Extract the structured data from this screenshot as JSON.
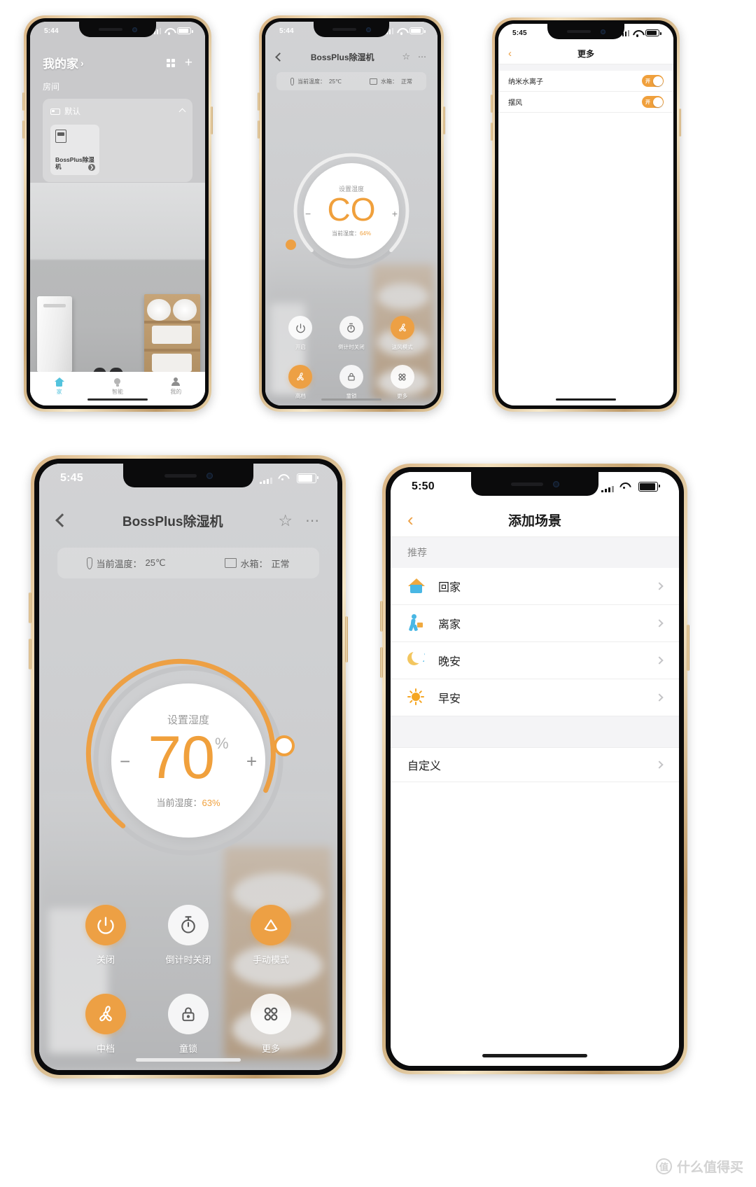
{
  "phones": {
    "home": {
      "status": {
        "time": "5:44"
      },
      "title": "我的家",
      "title_chevron": "›",
      "section_label": "房间",
      "room": {
        "name": "默认"
      },
      "device": {
        "name": "BossPlus除湿机",
        "arrow": "❯"
      },
      "tabs": [
        {
          "label": "家",
          "icon": "home-icon",
          "active": true
        },
        {
          "label": "智能",
          "icon": "bulb-icon",
          "active": false
        },
        {
          "label": "我的",
          "icon": "user-icon",
          "active": false
        }
      ]
    },
    "control_small": {
      "status": {
        "time": "5:44"
      },
      "title": "BossPlus除湿机",
      "info": {
        "temp_label": "当前温度：",
        "temp_value": "25℃",
        "tank_label": "水箱：",
        "tank_value": "正常"
      },
      "dial": {
        "label": "设置湿度",
        "value": "CO",
        "pct": "",
        "current_label": "当前湿度：",
        "current_value": "64%",
        "minus": "−",
        "plus": "+"
      },
      "buttons": [
        {
          "label": "开启",
          "icon": "power-icon",
          "state": "off"
        },
        {
          "label": "倒计时关闭",
          "icon": "timer-icon",
          "state": "off"
        },
        {
          "label": "送风模式",
          "icon": "fan-icon",
          "state": "on"
        },
        {
          "label": "高档",
          "icon": "fan-speed-icon",
          "state": "on"
        },
        {
          "label": "童锁",
          "icon": "lock-icon",
          "state": "off"
        },
        {
          "label": "更多",
          "icon": "more-grid-icon",
          "state": "off"
        }
      ]
    },
    "more": {
      "status": {
        "time": "5:45"
      },
      "title": "更多",
      "rows": [
        {
          "label": "纳米水离子",
          "toggle": "开",
          "on": true
        },
        {
          "label": "摆风",
          "toggle": "开",
          "on": true
        }
      ]
    },
    "control_large": {
      "status": {
        "time": "5:45"
      },
      "title": "BossPlus除湿机",
      "info": {
        "temp_label": "当前温度：",
        "temp_value": "25℃",
        "tank_label": "水箱：",
        "tank_value": "正常"
      },
      "dial": {
        "label": "设置湿度",
        "value": "70",
        "pct": "%",
        "current_label": "当前湿度：",
        "current_value": "63%",
        "minus": "−",
        "plus": "+"
      },
      "buttons": [
        {
          "label": "关闭",
          "icon": "power-icon",
          "state": "on"
        },
        {
          "label": "倒计时关闭",
          "icon": "timer-icon",
          "state": "off"
        },
        {
          "label": "手动模式",
          "icon": "manual-mode-icon",
          "state": "on"
        },
        {
          "label": "中档",
          "icon": "fan-speed-icon",
          "state": "on"
        },
        {
          "label": "童锁",
          "icon": "lock-icon",
          "state": "off"
        },
        {
          "label": "更多",
          "icon": "more-grid-icon",
          "state": "off"
        }
      ]
    },
    "scene": {
      "status": {
        "time": "5:50"
      },
      "title": "添加场景",
      "section_label": "推荐",
      "items": [
        {
          "label": "回家",
          "icon": "scene-home-icon"
        },
        {
          "label": "离家",
          "icon": "scene-leave-icon"
        },
        {
          "label": "晚安",
          "icon": "scene-night-icon"
        },
        {
          "label": "早安",
          "icon": "scene-morning-icon"
        }
      ],
      "custom_label": "自定义"
    }
  },
  "watermark": {
    "badge": "值",
    "text": "什么值得买"
  },
  "colors": {
    "accent": "#eda044",
    "tab_active": "#53c3dd",
    "scene_blue": "#49b7e4",
    "scene_yellow": "#f3c65f"
  }
}
